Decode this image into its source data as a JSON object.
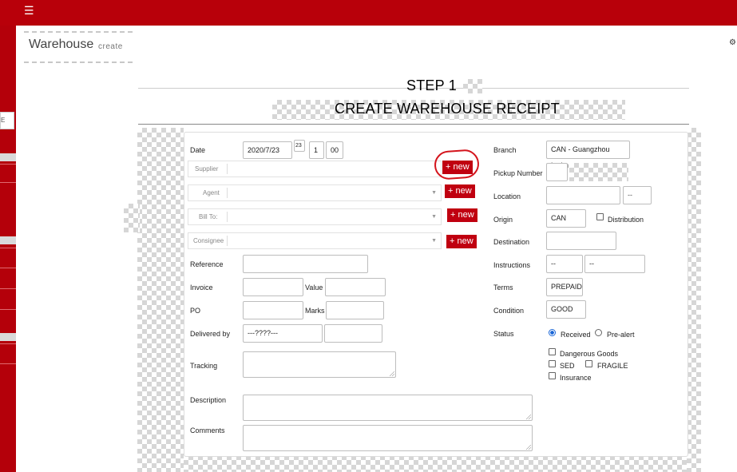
{
  "topbar": {
    "menu_icon": "hamburger-icon",
    "accent": "#b8000a"
  },
  "sidebar": {
    "input_text": "E"
  },
  "page": {
    "title": "Warehouse",
    "subtitle": "create"
  },
  "header": {
    "step": "STEP 1",
    "heading": "CREATE WAREHOUSE RECEIPT"
  },
  "form": {
    "date_label": "Date",
    "date_value": "2020/7/23",
    "calendar_icon_text": "23",
    "hour_value": "1",
    "minute_value": "00",
    "supplier_label": "Supplier",
    "agent_label": "Agent",
    "billto_label": "Bill To:",
    "consignee_label": "Consignee",
    "new_label": "+ new",
    "reference_label": "Reference",
    "invoice_label": "Invoice",
    "value_label": "Value",
    "po_label": "PO",
    "marks_label": "Marks",
    "delivered_label": "Delivered by",
    "delivered_value": "---????---",
    "tracking_label": "Tracking",
    "description_label": "Description",
    "comments_label": "Comments",
    "branch_label": "Branch",
    "branch_value": "CAN - Guangzhou Latim",
    "pickup_label": "Pickup Number",
    "location_label": "Location",
    "location_select": "--",
    "origin_label": "Origin",
    "origin_value": "CAN",
    "distribution_label": "Distribution",
    "destination_label": "Destination",
    "instructions_label": "Instructions",
    "instructions_1": "--",
    "instructions_2": "--",
    "terms_label": "Terms",
    "terms_value": "PREPAID",
    "condition_label": "Condition",
    "condition_value": "GOOD",
    "status_label": "Status",
    "received_label": "Received",
    "prealert_label": "Pre-alert",
    "dangerous_label": "Dangerous Goods",
    "sed_label": "SED",
    "fragile_label": "FRAGILE",
    "insurance_label": "Insurance"
  }
}
